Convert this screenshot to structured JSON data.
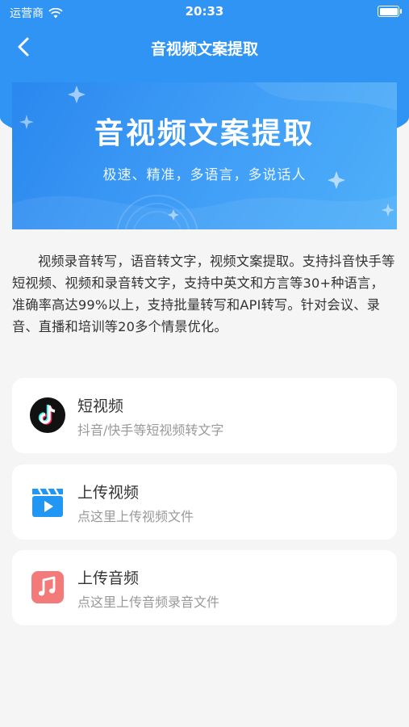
{
  "status_bar": {
    "carrier": "运营商",
    "time": "20:33"
  },
  "nav": {
    "title": "音视频文案提取"
  },
  "banner": {
    "title": "音视频文案提取",
    "subtitle": "极速、精准，多语言，多说话人"
  },
  "description": "视频录音转写，语音转文字，视频文案提取。支持抖音快手等短视频、视频和录音转文字，支持中英文和方言等30+种语言，准确率高达99%以上，支持批量转写和API转写。针对会议、录音、直播和培训等20多个情景优化。",
  "cards": [
    {
      "title": "短视频",
      "subtitle": "抖音/快手等短视频转文字",
      "icon": "tiktok-icon"
    },
    {
      "title": "上传视频",
      "subtitle": "点这里上传视频文件",
      "icon": "video-clapper-icon"
    },
    {
      "title": "上传音频",
      "subtitle": "点这里上传音频录音文件",
      "icon": "music-note-icon"
    }
  ],
  "colors": {
    "primary": "#2f94f4",
    "background": "#f5f5f5",
    "video_icon": "#2196f3",
    "audio_icon": "#f47a7a"
  }
}
